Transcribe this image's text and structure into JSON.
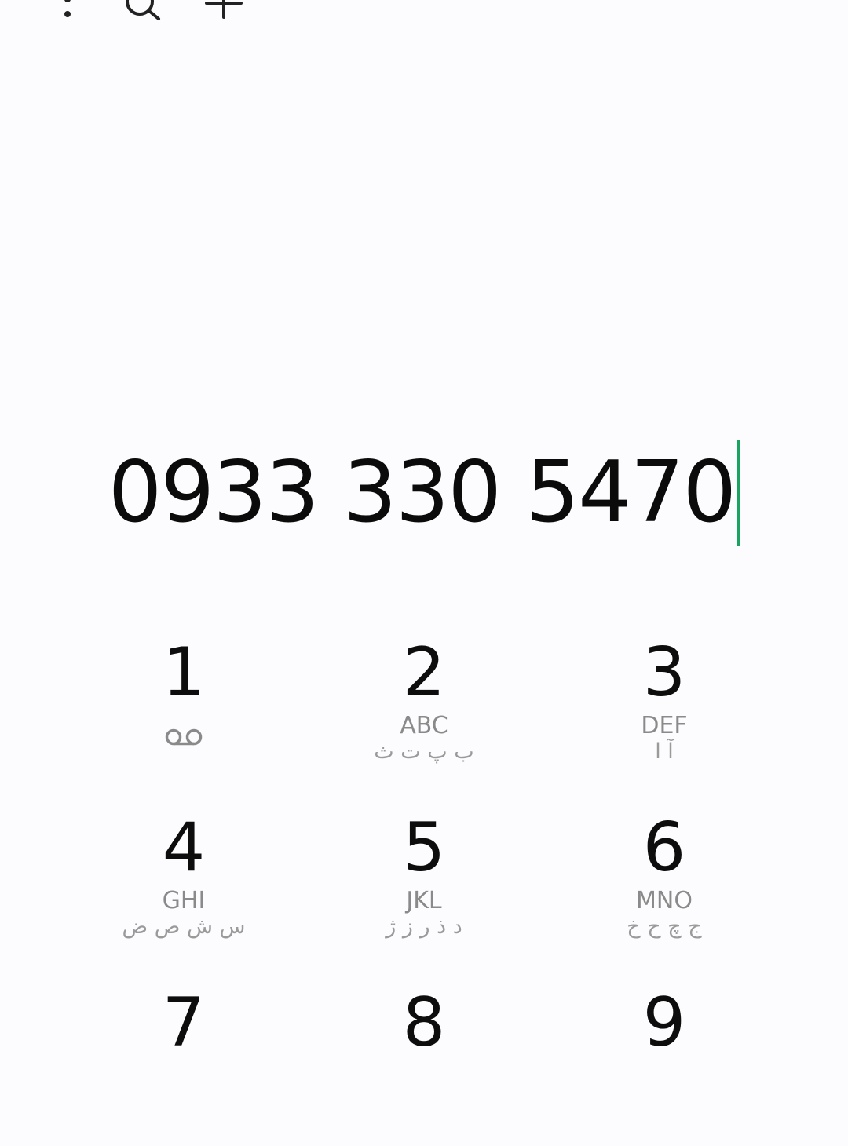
{
  "toolbar": {
    "more_icon": "more-vert-icon",
    "search_icon": "search-icon",
    "add_icon": "add-icon"
  },
  "dialer": {
    "number": "0933 330 5470",
    "cursor_color": "#1aa260"
  },
  "keypad": {
    "keys": [
      {
        "digit": "1",
        "letters": "",
        "alt": "",
        "icon": "voicemail-icon"
      },
      {
        "digit": "2",
        "letters": "ABC",
        "alt": "ب پ ت ث"
      },
      {
        "digit": "3",
        "letters": "DEF",
        "alt": "آ ا"
      },
      {
        "digit": "4",
        "letters": "GHI",
        "alt": "س ش ص ض"
      },
      {
        "digit": "5",
        "letters": "JKL",
        "alt": "د ذ ر ز ژ"
      },
      {
        "digit": "6",
        "letters": "MNO",
        "alt": "ج چ ح خ"
      },
      {
        "digit": "7",
        "letters": "",
        "alt": ""
      },
      {
        "digit": "8",
        "letters": "",
        "alt": ""
      },
      {
        "digit": "9",
        "letters": "",
        "alt": ""
      }
    ]
  }
}
